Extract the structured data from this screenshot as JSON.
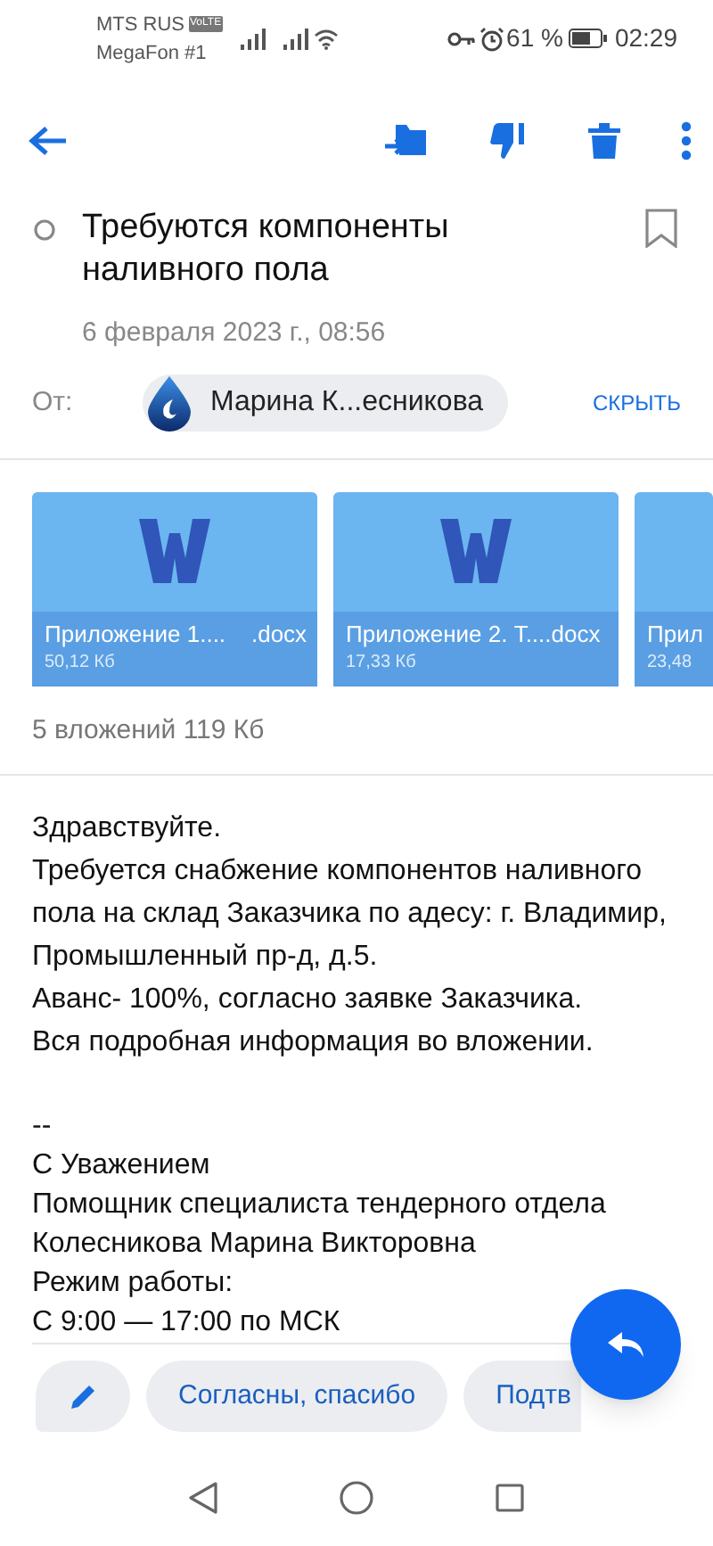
{
  "status_bar": {
    "carrier_1": "MTS RUS",
    "volte": "VoLTE",
    "carrier_2": "MegaFon #1",
    "battery": "61 %",
    "time": "02:29"
  },
  "message": {
    "unread": false,
    "flagged": false,
    "subject": "Требуются компоненты наливного пола",
    "date": "6 февраля 2023 г., 08:56",
    "from_label": "От:",
    "sender": "Марина К...есникова",
    "hide_link": "СКРЫТЬ"
  },
  "attachments": [
    {
      "name": "Приложение 1....    .docx",
      "size": "50,12 Кб"
    },
    {
      "name": "Приложение 2. Т....docx",
      "size": "17,33 Кб"
    },
    {
      "name": "Прил",
      "size": "23,48"
    }
  ],
  "attachments_summary": "5 вложений 119 Кб",
  "body": [
    "Здравствуйте.",
    "Требуется снабжение компонентов наливного пола на склад Заказчика по адесу: г. Владимир, Промышленный пр-д, д.5.",
    "Аванс- 100%, согласно заявке Заказчика.",
    "Вся подробная информация во вложении."
  ],
  "signature": [
    "--",
    "С Уважением",
    "Помощник специалиста тендерного отдела",
    "Колесникова Марина Викторовна",
    "Режим работы:",
    "С 9:00 — 17:00 по МСК"
  ],
  "quick_replies": [
    "Согласны, спасибо",
    "Подтв"
  ]
}
